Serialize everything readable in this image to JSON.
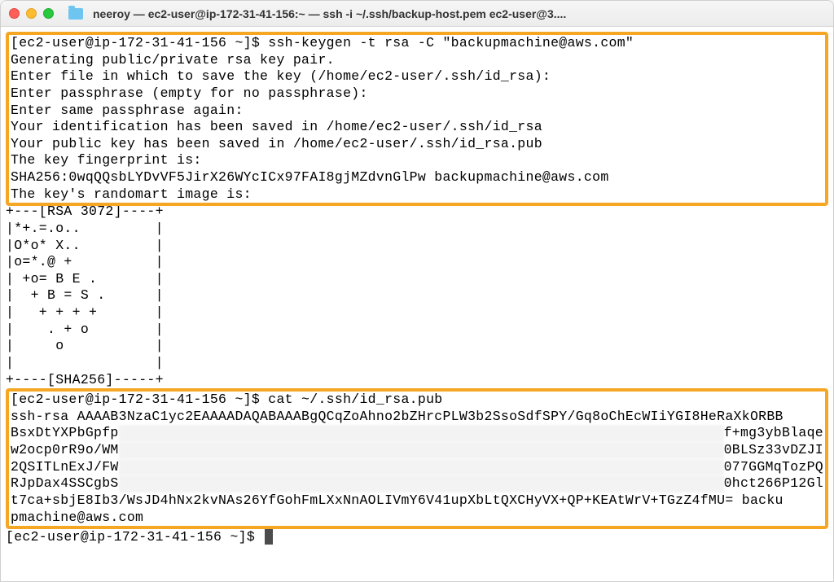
{
  "window": {
    "title": "neeroy — ec2-user@ip-172-31-41-156:~ — ssh -i ~/.ssh/backup-host.pem ec2-user@3...."
  },
  "terminal": {
    "box1_lines": [
      "[ec2-user@ip-172-31-41-156 ~]$ ssh-keygen -t rsa -C \"backupmachine@aws.com\"",
      "Generating public/private rsa key pair.",
      "Enter file in which to save the key (/home/ec2-user/.ssh/id_rsa):",
      "Enter passphrase (empty for no passphrase):",
      "Enter same passphrase again:",
      "Your identification has been saved in /home/ec2-user/.ssh/id_rsa",
      "Your public key has been saved in /home/ec2-user/.ssh/id_rsa.pub",
      "The key fingerprint is:",
      "SHA256:0wqQQsbLYDvVF5JirX26WYcICx97FAI8gjMZdvnGlPw backupmachine@aws.com",
      "The key's randomart image is:"
    ],
    "middle_lines": [
      "+---[RSA 3072]----+",
      "|*+.=.o..         |",
      "|O*o* X..         |",
      "|o=*.@ +          |",
      "| +o= B E .       |",
      "|  + B = S .      |",
      "|   + + + +       |",
      "|    . + o        |",
      "|     o           |",
      "|                 |",
      "+----[SHA256]-----+"
    ],
    "box2_prompt": "[ec2-user@ip-172-31-41-156 ~]$ cat ~/.ssh/id_rsa.pub",
    "box2_line1": "ssh-rsa AAAAB3NzaC1yc2EAAAADAQABAAABgQCqZoAhno2bZHrcPLW3b2SsoSdfSPY/Gq8oChEcWIiYGI8HeRaXkORBB",
    "box2_blurred": [
      {
        "left": "BsxDtYXPbGpfp",
        "right": "f+mg3ybBlaqe"
      },
      {
        "left": "w2ocp0rR9o/WM",
        "right": "0BLSz33vDZJI"
      },
      {
        "left": "2QSITLnExJ/FW",
        "right": "077GGMqTozPQ"
      },
      {
        "left": "RJpDax4SSCgbS",
        "right": "0hct266P12Gl"
      }
    ],
    "box2_line_last1": "t7ca+sbjE8Ib3/WsJD4hNx2kvNAs26YfGohFmLXxNnAOLIVmY6V41upXbLtQXCHyVX+QP+KEAtWrV+TGzZ4fMU= backu",
    "box2_line_last2": "pmachine@aws.com",
    "final_prompt": "[ec2-user@ip-172-31-41-156 ~]$ "
  }
}
